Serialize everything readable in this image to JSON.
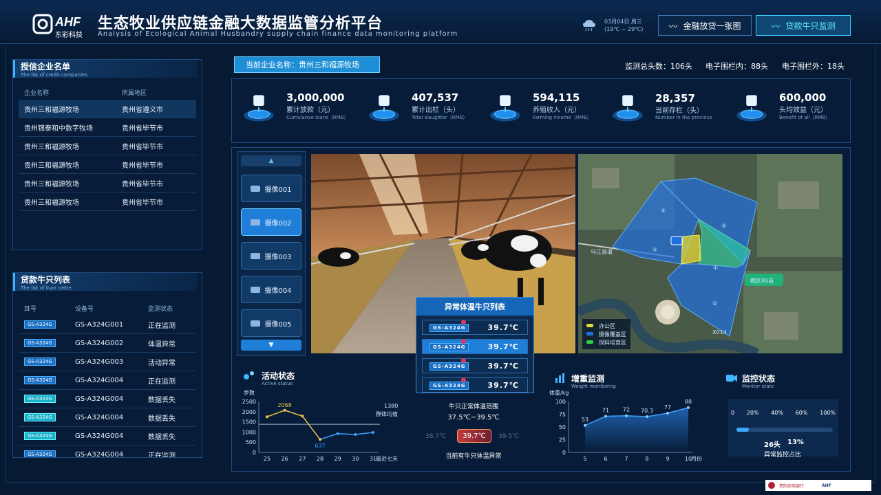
{
  "header": {
    "logo_text": "AHF",
    "logo_sub": "东彩科技",
    "title": "生态牧业供应链金融大数据监管分析平台",
    "subtitle": "Analysis of Ecological Animal Husbandry supply chain finance data monitoring platform",
    "date": "03月04日 周三",
    "temp": "(19℃ ~ 29℃)",
    "btn_finance": "金融放贷一张图",
    "btn_loan": "贷款牛只监测"
  },
  "credit": {
    "title": "授信企业名单",
    "title_en": "The list of credit companies",
    "col_name": "企业名称",
    "col_region": "所属地区",
    "rows": [
      {
        "name": "贵州三和福源牧场",
        "region": "贵州省遵义市"
      },
      {
        "name": "贵州锦泰和中数字牧场",
        "region": "贵州省毕节市"
      },
      {
        "name": "贵州三和福源牧场",
        "region": "贵州省毕节市"
      },
      {
        "name": "贵州三和福源牧场",
        "region": "贵州省毕节市"
      },
      {
        "name": "贵州三和福源牧场",
        "region": "贵州省毕节市"
      },
      {
        "name": "贵州三和福源牧场",
        "region": "贵州省毕节市"
      }
    ]
  },
  "cattle": {
    "title": "贷款牛只列表",
    "title_en": "The list of loan cattle",
    "col_ear": "耳号",
    "col_device": "设备号",
    "col_status": "监测状态",
    "rows": [
      {
        "ear": "GS-A324G",
        "device": "GS-A324G001",
        "status": "正在监测",
        "alert": true,
        "cyan": false
      },
      {
        "ear": "GS-A324G",
        "device": "GS-A324G002",
        "status": "体温异常",
        "alert": true,
        "cyan": false
      },
      {
        "ear": "GS-A324G",
        "device": "GS-A324G003",
        "status": "活动异常",
        "alert": true,
        "cyan": false
      },
      {
        "ear": "GS-A324G",
        "device": "GS-A324G004",
        "status": "正在监测",
        "alert": true,
        "cyan": false
      },
      {
        "ear": "GS-A324G",
        "device": "GS-A324G004",
        "status": "数据丢失",
        "alert": false,
        "cyan": true
      },
      {
        "ear": "GS-A324G",
        "device": "GS-A324G004",
        "status": "数据丢失",
        "alert": false,
        "cyan": true
      },
      {
        "ear": "GS-A324G",
        "device": "GS-A324G004",
        "status": "数据丢失",
        "alert": false,
        "cyan": true
      },
      {
        "ear": "GS-A324G",
        "device": "GS-A324G004",
        "status": "正在监测",
        "alert": false,
        "cyan": false
      }
    ]
  },
  "company_bar": {
    "current": "当前企业名称：贵州三和福源牧场",
    "total": "监测总头数：106头",
    "inside": "电子围栏内：88头",
    "outside": "电子围栏外：18头"
  },
  "stats": [
    {
      "value": "3,000,000",
      "label": "累计放款（元）",
      "en": "Cumulative loans（RMB）",
      "icon": "loan-icon"
    },
    {
      "value": "407,537",
      "label": "累计出栏（头）",
      "en": "Total slaughter（RMB）",
      "icon": "slaughter-icon"
    },
    {
      "value": "594,115",
      "label": "养殖收入（元）",
      "en": "Farming income（RMB）",
      "icon": "money-bag-icon"
    },
    {
      "value": "28,357",
      "label": "当前存栏（头）",
      "en": "Number in the province",
      "icon": "cow-icon"
    },
    {
      "value": "600,000",
      "label": "头均效益（元）",
      "en": "Benefit of all（RMB）",
      "icon": "benefit-icon"
    }
  ],
  "cameras": [
    "摄像001",
    "摄像002",
    "摄像003",
    "摄像004",
    "摄像005"
  ],
  "map": {
    "zones": [
      "①",
      "②",
      "③",
      "④",
      "⑤"
    ],
    "tag": "棚区80亩",
    "legend": [
      "办公区",
      "摄像覆盖区",
      "饲料培育区"
    ],
    "road": "X014",
    "road2": "乌江县道"
  },
  "abnormal": {
    "title": "异常体温牛只列表",
    "rows": [
      {
        "tag": "GS-A324G",
        "temp": "39.7℃"
      },
      {
        "tag": "GS-A324G",
        "temp": "39.7℃"
      },
      {
        "tag": "GS-A324G",
        "temp": "39.7℃"
      },
      {
        "tag": "GS-A324G",
        "temp": "39.7℃"
      }
    ],
    "range_label": "牛只正常体温范围",
    "range_value": "37.5℃~39.5℃",
    "dial": [
      "38.7℃",
      "39.7℃",
      "39.5℃"
    ],
    "current_label": "当前有牛只体温异常"
  },
  "activity": {
    "title": "活动状态",
    "title_en": "Active status",
    "unit": "步数",
    "avg_value": "1380",
    "avg_label": "群体均值",
    "x_suffix": "最近七天"
  },
  "weight": {
    "title": "增重监测",
    "title_en": "Weight monitoring",
    "unit": "体重/kg",
    "x_unit": "月份"
  },
  "monitor": {
    "title": "监控状态",
    "title_en": "Monitor state",
    "ticks": [
      "0",
      "20%",
      "40%",
      "60%",
      "100%"
    ],
    "progress": 0.13,
    "count": "26头",
    "percent": "13%",
    "label": "异常监控占比"
  },
  "chart_data": [
    {
      "type": "line",
      "x": [
        "25",
        "26",
        "27",
        "28",
        "29",
        "30",
        "31"
      ],
      "series": [
        {
          "values": [
            1750,
            2068,
            1780,
            637,
            920,
            880,
            980
          ]
        }
      ],
      "labels": {
        "1": "2068",
        "3": "637"
      },
      "ylim": [
        0,
        2500
      ],
      "yticks": [
        "0",
        "500",
        "1000",
        "1500",
        "2000",
        "2500"
      ],
      "reference": 1380
    },
    {
      "type": "area",
      "x": [
        "5",
        "6",
        "7",
        "8",
        "9",
        "10"
      ],
      "series": [
        {
          "values": [
            53,
            71,
            72,
            70.3,
            77,
            88
          ]
        }
      ],
      "labels": [
        "53",
        "71",
        "72",
        "70.3",
        "77",
        "88"
      ],
      "ylim": [
        0,
        100
      ],
      "yticks": [
        "0",
        "25",
        "50",
        "75",
        "100"
      ]
    }
  ],
  "footer": {
    "bank": "贵阳农商银行",
    "logo": "AHF"
  }
}
